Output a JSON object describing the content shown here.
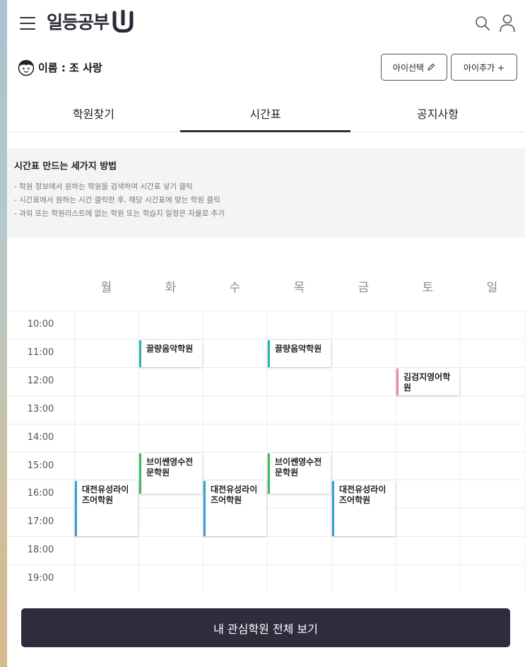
{
  "header": {
    "logo_text": "일등공부",
    "icons": [
      "menu-icon",
      "search-icon",
      "user-icon"
    ]
  },
  "profile": {
    "name_label": "이름 : 조 사랑",
    "select_child_label": "아이선택",
    "add_child_label": "아이추가 +"
  },
  "tabs": [
    {
      "label": "학원찾기",
      "active": false
    },
    {
      "label": "시간표",
      "active": true
    },
    {
      "label": "공지사항",
      "active": false
    }
  ],
  "info": {
    "title": "시간표 만드는 세가지 방법",
    "lines": [
      "- 학원 정보에서 원하는 학원을 검색하여 시간표 넣기 클릭",
      "- 시간표에서 원하는 시간 클릭한 후, 해당 시간표에 맞는 학원 클릭",
      "- 과외 또는 학원리스트에 없는 학원 또는 학습지 일정은 자율로 추가"
    ]
  },
  "timetable": {
    "days": [
      "월",
      "화",
      "수",
      "목",
      "금",
      "토",
      "일"
    ],
    "times": [
      "10:00",
      "11:00",
      "12:00",
      "13:00",
      "14:00",
      "15:00",
      "16:00",
      "17:00",
      "18:00",
      "19:00"
    ],
    "events": [
      {
        "name": "끌량음악학원",
        "day": "화",
        "start": "11:00",
        "end": "12:00",
        "color": "#2bb5b0"
      },
      {
        "name": "끌량음악학원",
        "day": "목",
        "start": "11:00",
        "end": "12:00",
        "color": "#2bb5b0"
      },
      {
        "name": "김검지영어학원",
        "day": "토",
        "start": "12:00",
        "end": "13:00",
        "color": "#ef8aa0"
      },
      {
        "name": "브이쎈영수전문학원",
        "day": "화",
        "start": "15:00",
        "end": "16:30",
        "color": "#3cc05a"
      },
      {
        "name": "브이쎈영수전문학원",
        "day": "목",
        "start": "15:00",
        "end": "16:30",
        "color": "#3cc05a"
      },
      {
        "name": "대전유성라이즈어학원",
        "day": "월",
        "start": "16:00",
        "end": "18:00",
        "color": "#3a9fe0"
      },
      {
        "name": "대전유성라이즈어학원",
        "day": "수",
        "start": "16:00",
        "end": "18:00",
        "color": "#3a9fe0"
      },
      {
        "name": "대전유성라이즈어학원",
        "day": "금",
        "start": "16:00",
        "end": "18:00",
        "color": "#3a9fe0"
      }
    ]
  },
  "bottom_button_label": "내 관심학원 전체 보기",
  "colors": {
    "primary_dark": "#2e2d3d",
    "accent_teal": "#2bb5b0",
    "accent_pink": "#ef8aa0",
    "accent_green": "#3cc05a",
    "accent_blue": "#3a9fe0"
  }
}
